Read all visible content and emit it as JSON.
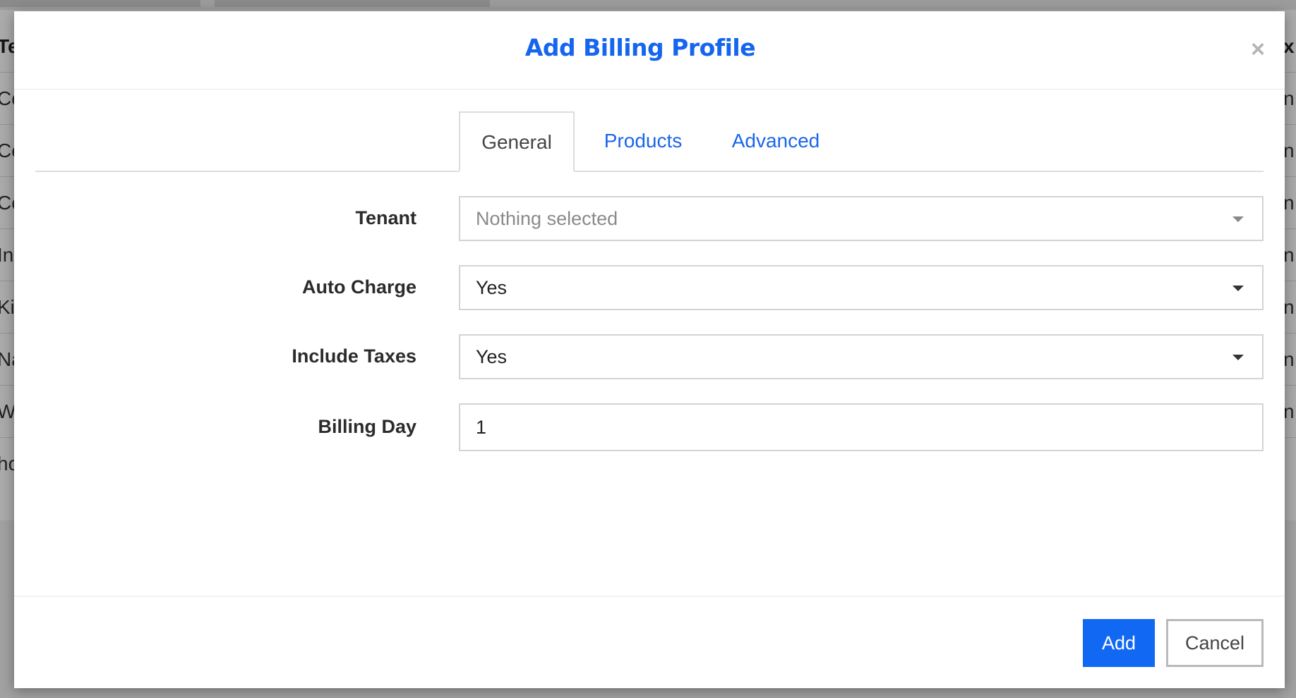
{
  "background": {
    "header_left": "Te",
    "header_right": "x",
    "rows_left": [
      "Co",
      "Co",
      "Co",
      "In",
      "Ki",
      "Na",
      "W",
      "ho"
    ],
    "rows_right": [
      "n",
      "n",
      "n",
      "n",
      "n",
      "n",
      "n",
      ""
    ]
  },
  "modal": {
    "title": "Add Billing Profile",
    "close_symbol": "×",
    "tabs": {
      "general": "General",
      "products": "Products",
      "advanced": "Advanced"
    },
    "form": {
      "tenant": {
        "label": "Tenant",
        "placeholder": "Nothing selected"
      },
      "auto_charge": {
        "label": "Auto Charge",
        "value": "Yes"
      },
      "include_taxes": {
        "label": "Include Taxes",
        "value": "Yes"
      },
      "billing_day": {
        "label": "Billing Day",
        "value": "1"
      }
    },
    "footer": {
      "add_label": "Add",
      "cancel_label": "Cancel"
    }
  },
  "colors": {
    "accent": "#1565ee",
    "add_button": "#1168f2",
    "overlay": "rgba(0,0,0,0.33)"
  },
  "icons": {
    "close": "close-icon",
    "dropdown": "caret-down-icon"
  }
}
